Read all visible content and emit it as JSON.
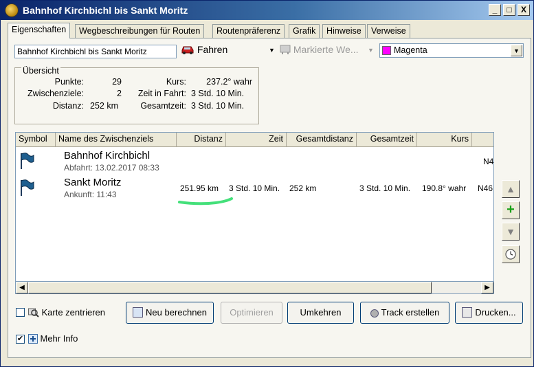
{
  "window": {
    "title": "Bahnhof Kirchbichl bis Sankt Moritz",
    "minimize": "_",
    "maximize": "□",
    "close": "X"
  },
  "tabs": [
    {
      "label": "Eigenschaften"
    },
    {
      "label": "Wegbeschreibungen für Routen"
    },
    {
      "label": "Routenpräferenz"
    },
    {
      "label": "Grafik"
    },
    {
      "label": "Hinweise"
    },
    {
      "label": "Verweise"
    }
  ],
  "route_name": "Bahnhof Kirchbichl bis Sankt Moritz",
  "mode": {
    "label": "Fahren",
    "icon": "car-icon"
  },
  "marker": {
    "label": "Markierte We...",
    "icon": "marker-icon"
  },
  "color": {
    "label": "Magenta",
    "hex": "#ff00ff"
  },
  "overview": {
    "title": "Übersicht",
    "punkte_label": "Punkte:",
    "punkte": "29",
    "zwischenziele_label": "Zwischenziele:",
    "zwischenziele": "2",
    "distanz_label": "Distanz:",
    "distanz": "252 km",
    "kurs_label": "Kurs:",
    "kurs": "237.2° wahr",
    "zeit_label": "Zeit in Fahrt:",
    "zeit": "3 Std. 10 Min.",
    "gesamtzeit_label": "Gesamtzeit:",
    "gesamtzeit": "3 Std. 10 Min."
  },
  "table": {
    "columns": [
      "Symbol",
      "Name des Zwischenziels",
      "Distanz",
      "Zeit",
      "Gesamtdistanz",
      "Gesamtzeit",
      "Kurs"
    ],
    "rows": [
      {
        "name": "Bahnhof Kirchbichl",
        "sub": "Abfahrt: 13.02.2017 08:33",
        "distanz": "",
        "zeit": "",
        "gesamtdistanz": "",
        "gesamtzeit": "",
        "kurs": "",
        "extra": "N4"
      },
      {
        "name": "Sankt Moritz",
        "sub": "Ankunft: 11:43",
        "distanz": "251.95 km",
        "zeit": "3 Std. 10 Min.",
        "gesamtdistanz": "252 km",
        "gesamtzeit": "3 Std. 10 Min.",
        "kurs": "190.8° wahr",
        "extra": "N46"
      }
    ]
  },
  "buttons": {
    "karte_zentrieren": "Karte zentrieren",
    "neu_berechnen": "Neu berechnen",
    "optimieren": "Optimieren",
    "umkehren": "Umkehren",
    "track_erstellen": "Track erstellen",
    "drucken": "Drucken...",
    "mehr_info": "Mehr Info"
  },
  "checkboxes": {
    "karte_zentrieren_checked": false,
    "mehr_info_checked": true
  }
}
